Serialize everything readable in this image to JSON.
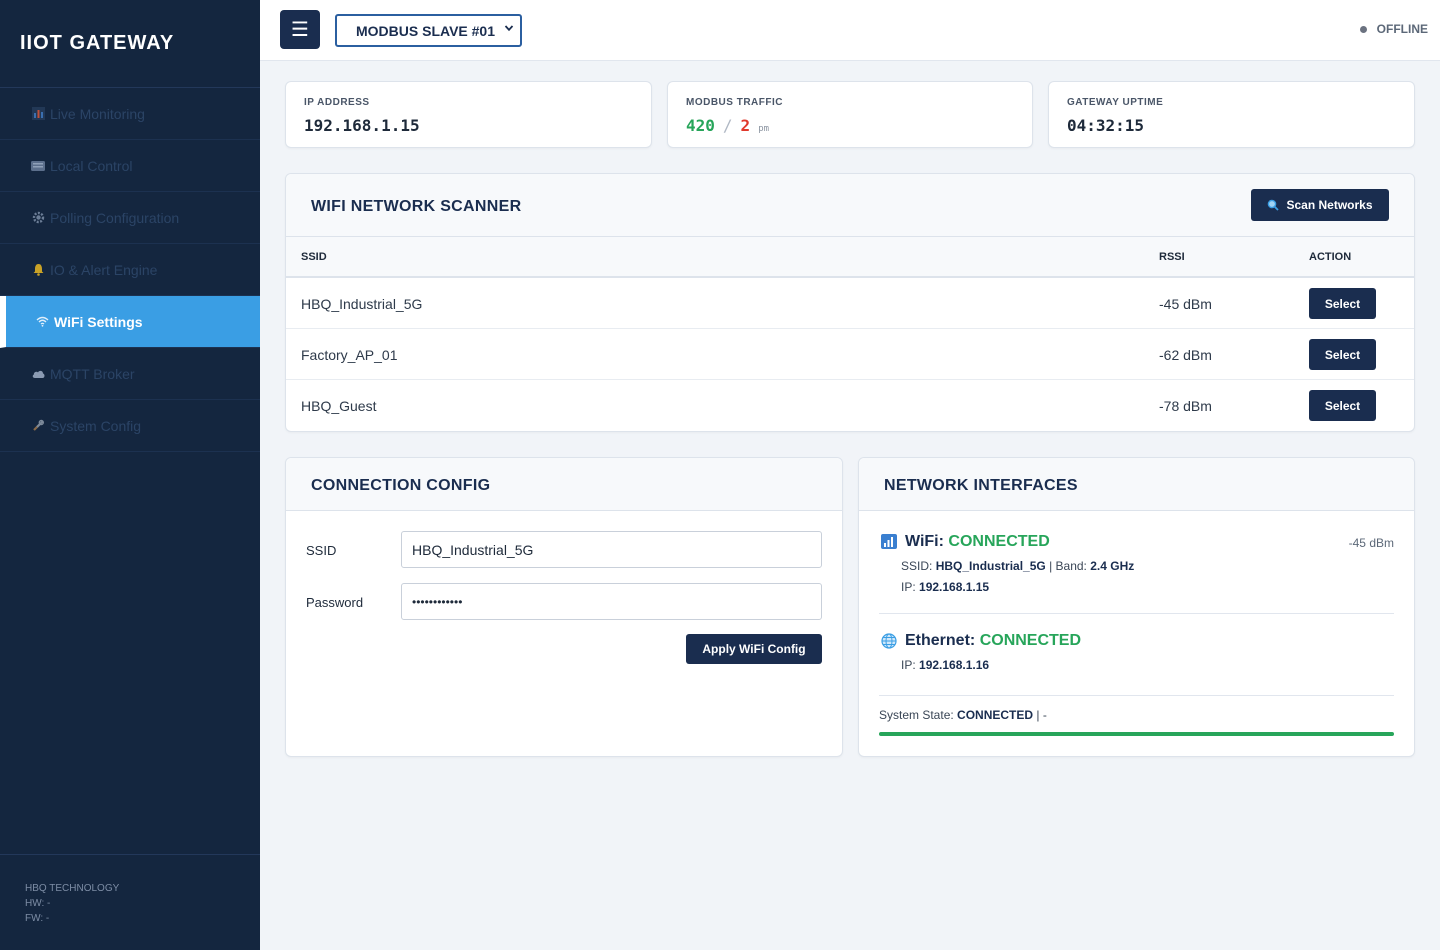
{
  "sidebar": {
    "brand": "IIOT GATEWAY",
    "items": [
      {
        "label": "Live Monitoring",
        "icon": "bar-chart-icon"
      },
      {
        "label": "Local Control",
        "icon": "keyboard-icon"
      },
      {
        "label": "Polling Configuration",
        "icon": "gear-icon"
      },
      {
        "label": "IO & Alert Engine",
        "icon": "bell-icon"
      },
      {
        "label": "WiFi Settings",
        "icon": "wifi-icon",
        "active": true
      },
      {
        "label": "MQTT Broker",
        "icon": "cloud-icon"
      },
      {
        "label": "System Config",
        "icon": "tools-icon"
      }
    ],
    "footer": {
      "company": "HBQ TECHNOLOGY",
      "hw": "HW: -",
      "fw": "FW: -"
    }
  },
  "topbar": {
    "menu_glyph": "☰",
    "slave_select": "MODBUS SLAVE #01",
    "status": "OFFLINE"
  },
  "stats": {
    "ip": {
      "label": "IP ADDRESS",
      "value": "192.168.1.15"
    },
    "traffic": {
      "label": "MODBUS TRAFFIC",
      "ok": "420",
      "sep": "/",
      "err": "2",
      "unit": "pm"
    },
    "uptime": {
      "label": "GATEWAY UPTIME",
      "value": "04:32:15"
    }
  },
  "scanner": {
    "title": "WIFI NETWORK SCANNER",
    "scan_button": "Scan Networks",
    "columns": {
      "ssid": "SSID",
      "rssi": "RSSI",
      "action": "ACTION"
    },
    "rows": [
      {
        "ssid": "HBQ_Industrial_5G",
        "rssi": "-45 dBm",
        "action": "Select"
      },
      {
        "ssid": "Factory_AP_01",
        "rssi": "-62 dBm",
        "action": "Select"
      },
      {
        "ssid": "HBQ_Guest",
        "rssi": "-78 dBm",
        "action": "Select"
      }
    ]
  },
  "config": {
    "title": "CONNECTION CONFIG",
    "ssid_label": "SSID",
    "ssid_value": "HBQ_Industrial_5G",
    "password_label": "Password",
    "password_value": "••••••••••••",
    "apply_button": "Apply WiFi Config"
  },
  "interfaces": {
    "title": "NETWORK INTERFACES",
    "wifi": {
      "name": "WiFi:",
      "state": "CONNECTED",
      "rssi": "-45 dBm",
      "ssid_label": "SSID:",
      "ssid": "HBQ_Industrial_5G",
      "band_label": "| Band:",
      "band": "2.4 GHz",
      "ip_label": "IP:",
      "ip": "192.168.1.15"
    },
    "ethernet": {
      "name": "Ethernet:",
      "state": "CONNECTED",
      "ip_label": "IP:",
      "ip": "192.168.1.16"
    },
    "system": {
      "label": "System State:",
      "state": "CONNECTED",
      "suffix": "| -",
      "progress": 1.0
    }
  },
  "colors": {
    "accent": "#3a9ee4",
    "navy": "#1a2d4f",
    "success": "#27a55a",
    "error": "#e0392c"
  }
}
